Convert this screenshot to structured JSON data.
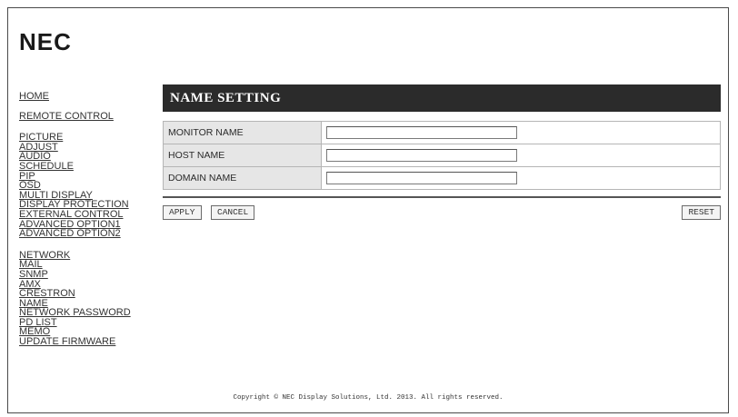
{
  "brand": {
    "logo": "NEC"
  },
  "nav": {
    "group1": [
      "HOME",
      "REMOTE CONTROL"
    ],
    "group2": [
      "PICTURE",
      "ADJUST",
      "AUDIO",
      "SCHEDULE",
      "PIP",
      "OSD",
      "MULTI DISPLAY",
      "DISPLAY PROTECTION",
      "EXTERNAL CONTROL",
      "ADVANCED OPTION1",
      "ADVANCED OPTION2"
    ],
    "group3": [
      "NETWORK",
      "MAIL",
      "SNMP",
      "AMX",
      "CRESTRON",
      "NAME",
      "NETWORK PASSWORD",
      "PD LIST",
      "MEMO",
      "UPDATE FIRMWARE"
    ]
  },
  "main": {
    "title": "NAME SETTING",
    "fields": [
      {
        "label": "MONITOR NAME",
        "value": ""
      },
      {
        "label": "HOST NAME",
        "value": ""
      },
      {
        "label": "DOMAIN NAME",
        "value": ""
      }
    ],
    "buttons": {
      "apply": "APPLY",
      "cancel": "CANCEL",
      "reset": "RESET"
    }
  },
  "footer": {
    "copyright": "Copyright © NEC Display Solutions, Ltd. 2013. All rights reserved."
  }
}
